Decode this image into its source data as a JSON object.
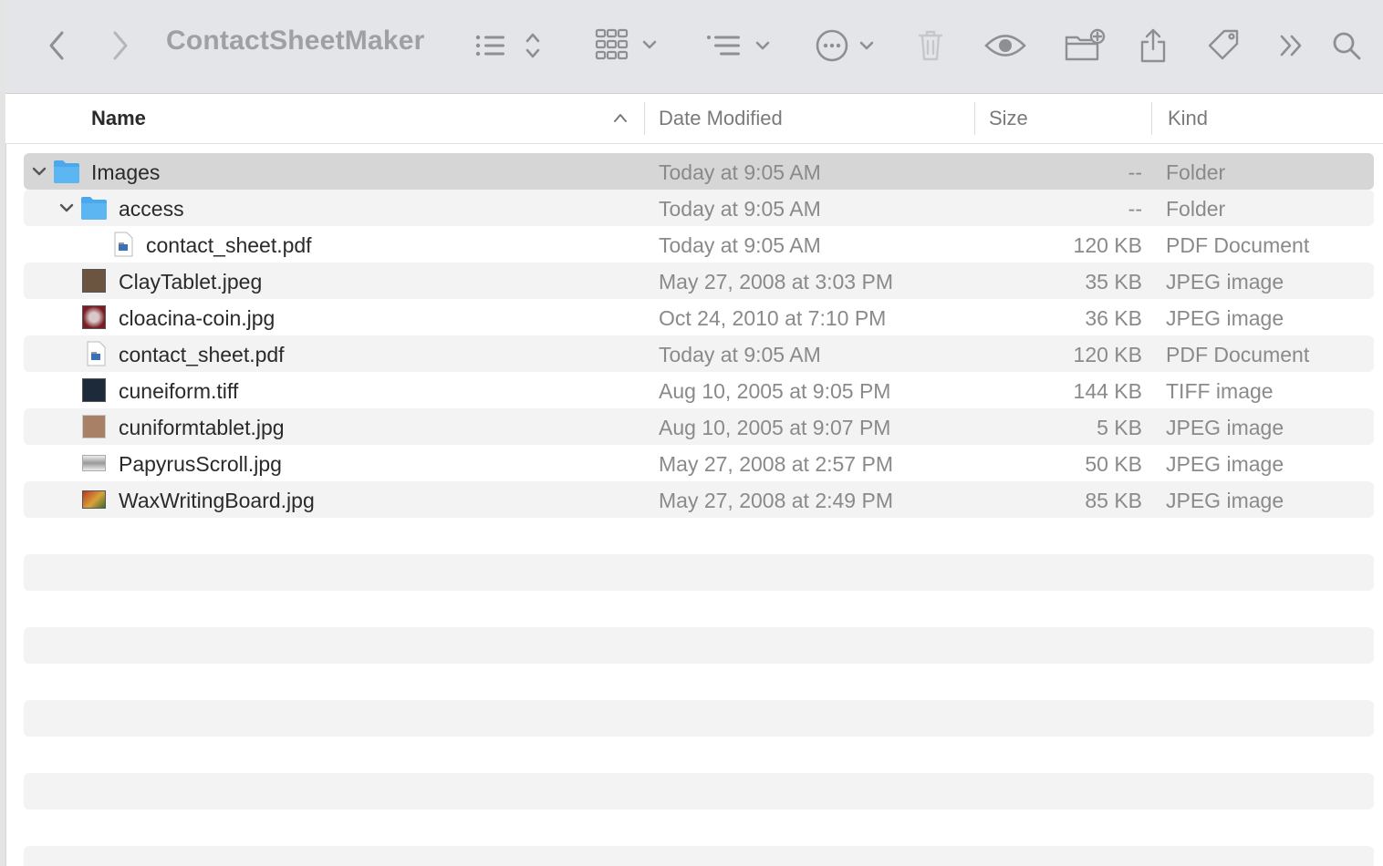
{
  "window": {
    "title": "ContactSheetMaker"
  },
  "toolbar": {
    "icons": [
      "back-icon",
      "forward-icon",
      "list-view-icon",
      "sort-updown-icon",
      "grid-view-icon",
      "chevron-down-icon",
      "group-icon",
      "more-icon",
      "trash-icon",
      "quicklook-eye-icon",
      "new-folder-icon",
      "share-icon",
      "tag-icon",
      "overflow-icon",
      "search-icon"
    ]
  },
  "columns": {
    "name": "Name",
    "date": "Date Modified",
    "size": "Size",
    "kind": "Kind"
  },
  "rows": [
    {
      "name": "Images",
      "date": "Today at 9:05 AM",
      "size": "--",
      "kind": "Folder"
    },
    {
      "name": "access",
      "date": "Today at 9:05 AM",
      "size": "--",
      "kind": "Folder"
    },
    {
      "name": "contact_sheet.pdf",
      "date": "Today at 9:05 AM",
      "size": "120 KB",
      "kind": "PDF Document"
    },
    {
      "name": "ClayTablet.jpeg",
      "date": "May 27, 2008 at 3:03 PM",
      "size": "35 KB",
      "kind": "JPEG image"
    },
    {
      "name": "cloacina-coin.jpg",
      "date": "Oct 24, 2010 at 7:10 PM",
      "size": "36 KB",
      "kind": "JPEG image"
    },
    {
      "name": "contact_sheet.pdf",
      "date": "Today at 9:05 AM",
      "size": "120 KB",
      "kind": "PDF Document"
    },
    {
      "name": "cuneiform.tiff",
      "date": "Aug 10, 2005 at 9:05 PM",
      "size": "144 KB",
      "kind": "TIFF image"
    },
    {
      "name": "cuniformtablet.jpg",
      "date": "Aug 10, 2005 at 9:07 PM",
      "size": "5 KB",
      "kind": "JPEG image"
    },
    {
      "name": "PapyrusScroll.jpg",
      "date": "May 27, 2008 at 2:57 PM",
      "size": "50 KB",
      "kind": "JPEG image"
    },
    {
      "name": "WaxWritingBoard.jpg",
      "date": "May 27, 2008 at 2:49 PM",
      "size": "85 KB",
      "kind": "JPEG image"
    }
  ],
  "colors": {
    "folder": "#4aa8ec",
    "selection": "#d6d6d6",
    "stripe": "#f3f3f3",
    "toolbar": "#e3e5e8"
  }
}
